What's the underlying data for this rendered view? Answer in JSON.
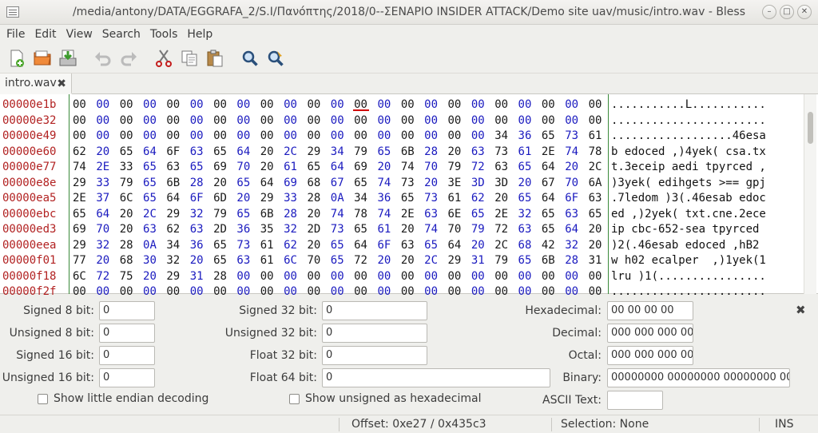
{
  "window": {
    "title": "/media/antony/DATA/EGGRAFA_2/S.I/Πανόπτης/2018/0--ΣΕΝΑΡΙΟ INSIDER ATTACK/Demo site uav/music/intro.wav - Bless"
  },
  "menubar": [
    "File",
    "Edit",
    "View",
    "Search",
    "Tools",
    "Help"
  ],
  "toolbar": [
    "new-file-icon",
    "open-folder-icon",
    "save-icon",
    "undo-icon",
    "redo-icon",
    "cut-icon",
    "copy-icon",
    "paste-icon",
    "find-icon",
    "find-replace-icon"
  ],
  "tab": {
    "label": "intro.wav",
    "close": "✖"
  },
  "hex_view": {
    "offsets": [
      "00000e1b",
      "00000e32",
      "00000e49",
      "00000e60",
      "00000e77",
      "00000e8e",
      "00000ea5",
      "00000ebc",
      "00000ed3",
      "00000eea",
      "00000f01",
      "00000f18",
      "00000f2f"
    ],
    "rows": [
      [
        "00",
        "00",
        "00",
        "00",
        "00",
        "00",
        "00",
        "00",
        "00",
        "00",
        "00",
        "00",
        "00",
        "00",
        "00",
        "00",
        "00",
        "00",
        "00",
        "00",
        "00",
        "00",
        "00"
      ],
      [
        "00",
        "00",
        "00",
        "00",
        "00",
        "00",
        "00",
        "00",
        "00",
        "00",
        "00",
        "00",
        "00",
        "00",
        "00",
        "00",
        "00",
        "00",
        "00",
        "00",
        "00",
        "00",
        "00"
      ],
      [
        "00",
        "00",
        "00",
        "00",
        "00",
        "00",
        "00",
        "00",
        "00",
        "00",
        "00",
        "00",
        "00",
        "00",
        "00",
        "00",
        "00",
        "00",
        "34",
        "36",
        "65",
        "73",
        "61"
      ],
      [
        "62",
        "20",
        "65",
        "64",
        "6F",
        "63",
        "65",
        "64",
        "20",
        "2C",
        "29",
        "34",
        "79",
        "65",
        "6B",
        "28",
        "20",
        "63",
        "73",
        "61",
        "2E",
        "74",
        "78"
      ],
      [
        "74",
        "2E",
        "33",
        "65",
        "63",
        "65",
        "69",
        "70",
        "20",
        "61",
        "65",
        "64",
        "69",
        "20",
        "74",
        "70",
        "79",
        "72",
        "63",
        "65",
        "64",
        "20",
        "2C"
      ],
      [
        "29",
        "33",
        "79",
        "65",
        "6B",
        "28",
        "20",
        "65",
        "64",
        "69",
        "68",
        "67",
        "65",
        "74",
        "73",
        "20",
        "3E",
        "3D",
        "3D",
        "20",
        "67",
        "70",
        "6A"
      ],
      [
        "2E",
        "37",
        "6C",
        "65",
        "64",
        "6F",
        "6D",
        "20",
        "29",
        "33",
        "28",
        "0A",
        "34",
        "36",
        "65",
        "73",
        "61",
        "62",
        "20",
        "65",
        "64",
        "6F",
        "63"
      ],
      [
        "65",
        "64",
        "20",
        "2C",
        "29",
        "32",
        "79",
        "65",
        "6B",
        "28",
        "20",
        "74",
        "78",
        "74",
        "2E",
        "63",
        "6E",
        "65",
        "2E",
        "32",
        "65",
        "63",
        "65"
      ],
      [
        "69",
        "70",
        "20",
        "63",
        "62",
        "63",
        "2D",
        "36",
        "35",
        "32",
        "2D",
        "73",
        "65",
        "61",
        "20",
        "74",
        "70",
        "79",
        "72",
        "63",
        "65",
        "64",
        "20"
      ],
      [
        "29",
        "32",
        "28",
        "0A",
        "34",
        "36",
        "65",
        "73",
        "61",
        "62",
        "20",
        "65",
        "64",
        "6F",
        "63",
        "65",
        "64",
        "20",
        "2C",
        "68",
        "42",
        "32",
        "20"
      ],
      [
        "77",
        "20",
        "68",
        "30",
        "32",
        "20",
        "65",
        "63",
        "61",
        "6C",
        "70",
        "65",
        "72",
        "20",
        "20",
        "2C",
        "29",
        "31",
        "79",
        "65",
        "6B",
        "28",
        "31"
      ],
      [
        "6C",
        "72",
        "75",
        "20",
        "29",
        "31",
        "28",
        "00",
        "00",
        "00",
        "00",
        "00",
        "00",
        "00",
        "00",
        "00",
        "00",
        "00",
        "00",
        "00",
        "00",
        "00",
        "00"
      ],
      [
        "00",
        "00",
        "00",
        "00",
        "00",
        "00",
        "00",
        "00",
        "00",
        "00",
        "00",
        "00",
        "00",
        "00",
        "00",
        "00",
        "00",
        "00",
        "00",
        "00",
        "00",
        "00",
        "00"
      ]
    ],
    "ascii": [
      "...........L...........",
      ".......................",
      "..................46esa",
      "b edoced ,)4yek( csa.tx",
      "t.3eceip aedi tpyrced ,",
      ")3yek( edihgets >== gpj",
      ".7ledom )3(.46esab edoc",
      "ed ,)2yek( txt.cne.2ece",
      "ip cbc-652-sea tpyrced",
      ")2(.46esab edoced ,hB2",
      "w h02 ecalper  ,)1yek(1",
      "lru )1(................",
      "......................."
    ]
  },
  "converter": {
    "signed8_label": "Signed 8 bit:",
    "signed8_value": "0",
    "unsigned8_label": "Unsigned 8 bit:",
    "unsigned8_value": "0",
    "signed16_label": "Signed 16 bit:",
    "signed16_value": "0",
    "unsigned16_label": "Unsigned 16 bit:",
    "unsigned16_value": "0",
    "signed32_label": "Signed 32 bit:",
    "signed32_value": "0",
    "unsigned32_label": "Unsigned 32 bit:",
    "unsigned32_value": "0",
    "float32_label": "Float 32 bit:",
    "float32_value": "0",
    "float64_label": "Float 64 bit:",
    "float64_value": "0",
    "hex_label": "Hexadecimal:",
    "hex_value": "00 00 00 00",
    "dec_label": "Decimal:",
    "dec_value": "000 000 000 000",
    "oct_label": "Octal:",
    "oct_value": "000 000 000 000",
    "bin_label": "Binary:",
    "bin_value": "00000000 00000000 00000000 00000000",
    "ascii_label": "ASCII Text:",
    "ascii_value": "",
    "little_endian_label": "Show little endian decoding",
    "unsigned_hex_label": "Show unsigned as hexadecimal",
    "close": "✖"
  },
  "statusbar": {
    "offset": "Offset: 0xe27 / 0x435c3",
    "selection": "Selection: None",
    "mode": "INS"
  }
}
